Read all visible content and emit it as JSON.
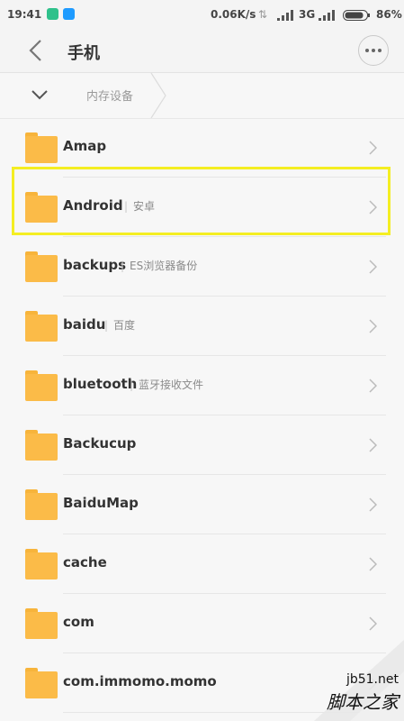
{
  "status_bar": {
    "time": "19:41",
    "net_speed": "0.06K/s",
    "network": "3G",
    "battery": "86%"
  },
  "header": {
    "title": "手机"
  },
  "breadcrumb": {
    "location": "内存设备"
  },
  "folders": [
    {
      "name": "Amap",
      "note": ""
    },
    {
      "name": "Android",
      "note": "安卓"
    },
    {
      "name": "backups",
      "note": "ES浏览器备份"
    },
    {
      "name": "baidu",
      "note": "百度"
    },
    {
      "name": "bluetooth",
      "note": "蓝牙接收文件"
    },
    {
      "name": "Backucup",
      "note": ""
    },
    {
      "name": "BaiduMap",
      "note": ""
    },
    {
      "name": "cache",
      "note": ""
    },
    {
      "name": "com",
      "note": ""
    },
    {
      "name": "com.immomo.momo",
      "note": ""
    }
  ],
  "watermark": {
    "url": "jb51.net",
    "text": "脚本之家"
  },
  "colors": {
    "folder": "#fbbb48",
    "highlight": "#f4ee22"
  }
}
